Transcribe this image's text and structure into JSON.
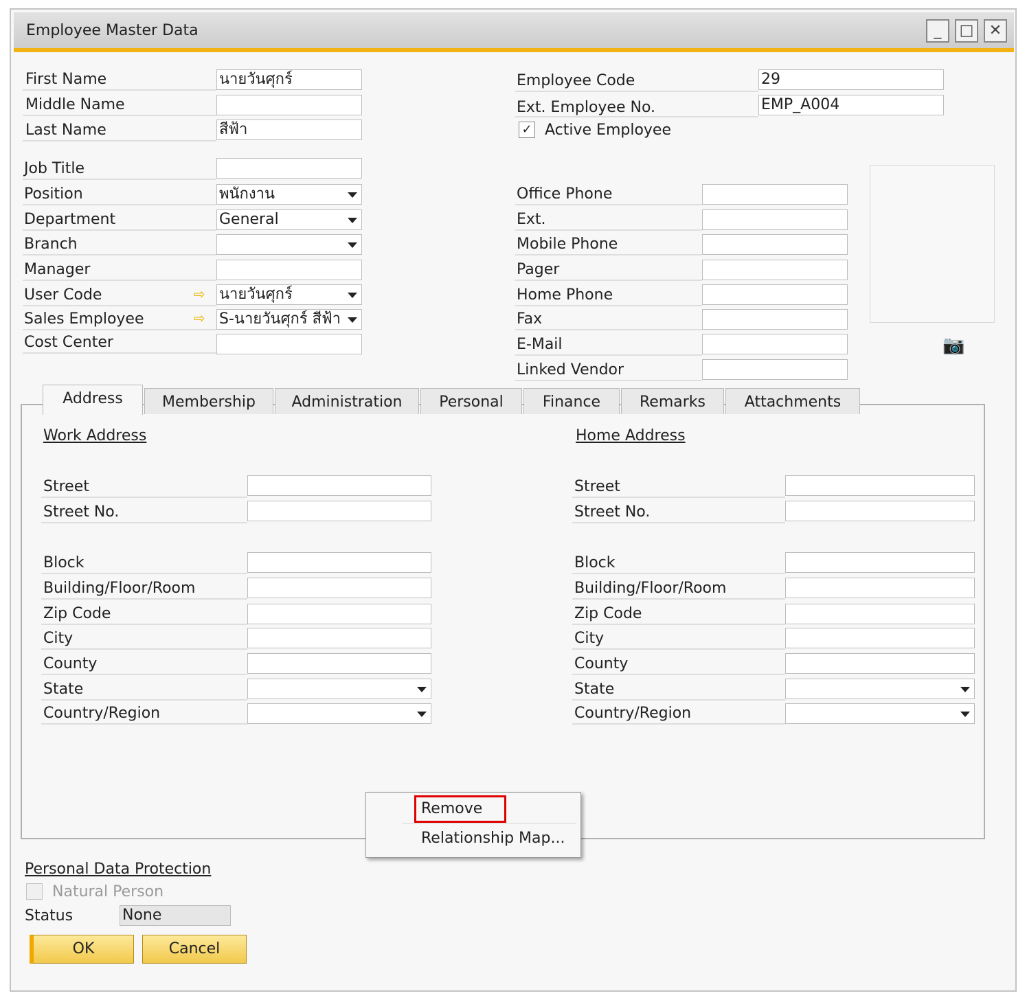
{
  "window": {
    "title": "Employee Master Data",
    "controls": {
      "minimize": "_",
      "maximize": "□",
      "close": "✕"
    }
  },
  "general_left": {
    "first_name_label": "First Name",
    "first_name_value": "นายวันศุกร์",
    "middle_name_label": "Middle Name",
    "middle_name_value": "",
    "last_name_label": "Last Name",
    "last_name_value": "สีฟ้า",
    "job_title_label": "Job Title",
    "job_title_value": "",
    "position_label": "Position",
    "position_value": "พนักงาน",
    "department_label": "Department",
    "department_value": "General",
    "branch_label": "Branch",
    "branch_value": "",
    "manager_label": "Manager",
    "manager_value": "",
    "user_code_label": "User Code",
    "user_code_value": "นายวันศุกร์",
    "sales_employee_label": "Sales Employee",
    "sales_employee_value": "S-นายวันศุกร์ สีฟ้า",
    "cost_center_label": "Cost Center",
    "cost_center_value": ""
  },
  "general_right": {
    "employee_code_label": "Employee Code",
    "employee_code_value": "29",
    "ext_employee_no_label": "Ext. Employee No.",
    "ext_employee_no_value": "EMP_A004",
    "active_employee_label": "Active Employee",
    "active_employee_checked": "✓",
    "office_phone_label": "Office Phone",
    "ext_label": "Ext.",
    "mobile_phone_label": "Mobile Phone",
    "pager_label": "Pager",
    "home_phone_label": "Home Phone",
    "fax_label": "Fax",
    "email_label": "E-Mail",
    "linked_vendor_label": "Linked Vendor",
    "camera_icon": "📷"
  },
  "tabs": [
    {
      "label": "Address"
    },
    {
      "label": "Membership"
    },
    {
      "label": "Administration"
    },
    {
      "label": "Personal"
    },
    {
      "label": "Finance"
    },
    {
      "label": "Remarks"
    },
    {
      "label": "Attachments"
    }
  ],
  "address": {
    "work_title": "Work Address",
    "home_title": "Home Address",
    "street": "Street",
    "street_no": "Street No.",
    "block": "Block",
    "building": "Building/Floor/Room",
    "zip": "Zip Code",
    "city": "City",
    "county": "County",
    "state": "State",
    "country": "Country/Region"
  },
  "context_menu": {
    "remove": "Remove",
    "relationship_map": "Relationship Map..."
  },
  "footer": {
    "pdp_title": "Personal Data Protection",
    "natural_person_label": "Natural Person",
    "status_label": "Status",
    "status_value": "None",
    "ok_label": "OK",
    "cancel_label": "Cancel"
  },
  "colors": {
    "accent": "#f3b214",
    "button_fill": "#f2c94c",
    "highlight_box": "#e00000"
  }
}
